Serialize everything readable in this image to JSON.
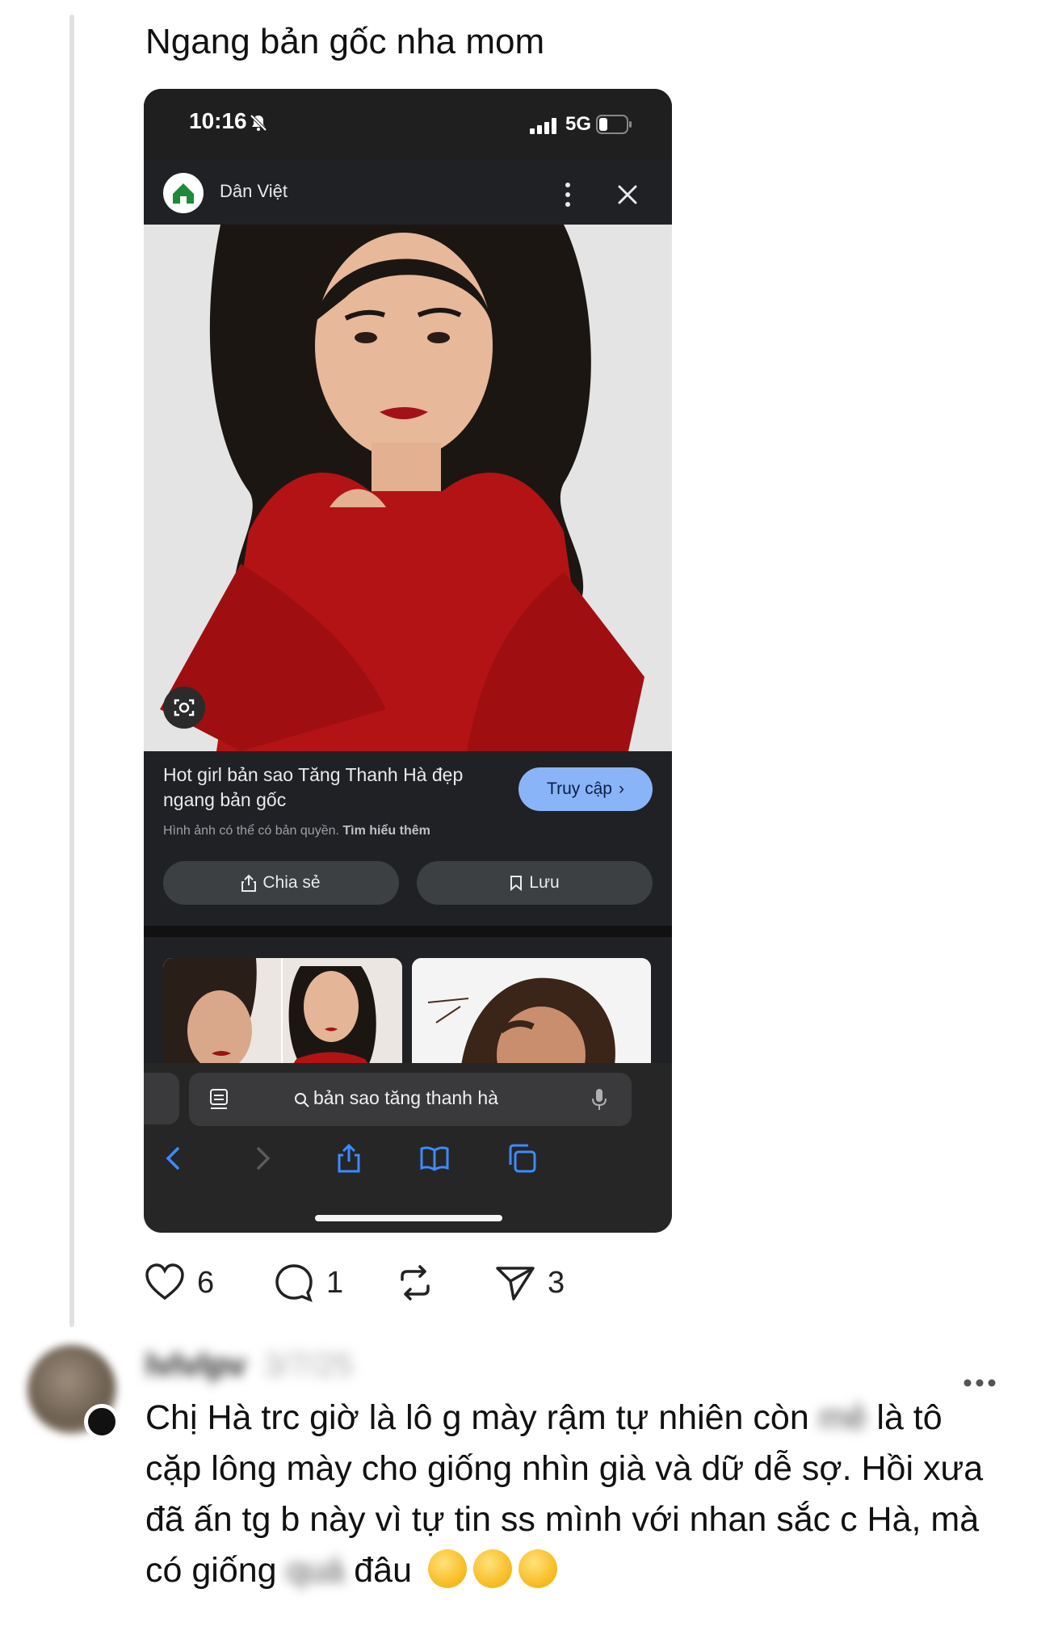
{
  "post": {
    "text": "Ngang bản gốc nha mom"
  },
  "phone": {
    "status_time": "10:16",
    "network": "5G",
    "site_name": "Dân Việt",
    "image_title": "Hot girl bản sao Tăng Thanh Hà đẹp ngang bản gốc",
    "visit_label": "Truy cập",
    "copyright_text": "Hình ảnh có thể có bản quyền.",
    "learn_more": "Tìm hiểu thêm",
    "share_label": "Chia sẻ",
    "save_label": "Lưu",
    "search_query": "bản sao tăng thanh hà",
    "accent": "#8ab4f8"
  },
  "actions": {
    "likes": "6",
    "comments": "1",
    "shares": "3"
  },
  "reply": {
    "username": "lvlvlpv",
    "date": "3/7/25",
    "text_1": "Chị Hà trc giờ là lô g mày rậm tự nhiên còn",
    "hidden_1": "mẻ",
    "text_2": "là tô cặp lông mày cho giống nhìn già và dữ dễ sợ. Hồi xưa đã ấn tg b này vì tự tin ss mình với nhan sắc c Hà, mà có giống",
    "hidden_2": "quá",
    "text_3": "đâu",
    "emoji": "rolling-on-floor-laughing"
  }
}
